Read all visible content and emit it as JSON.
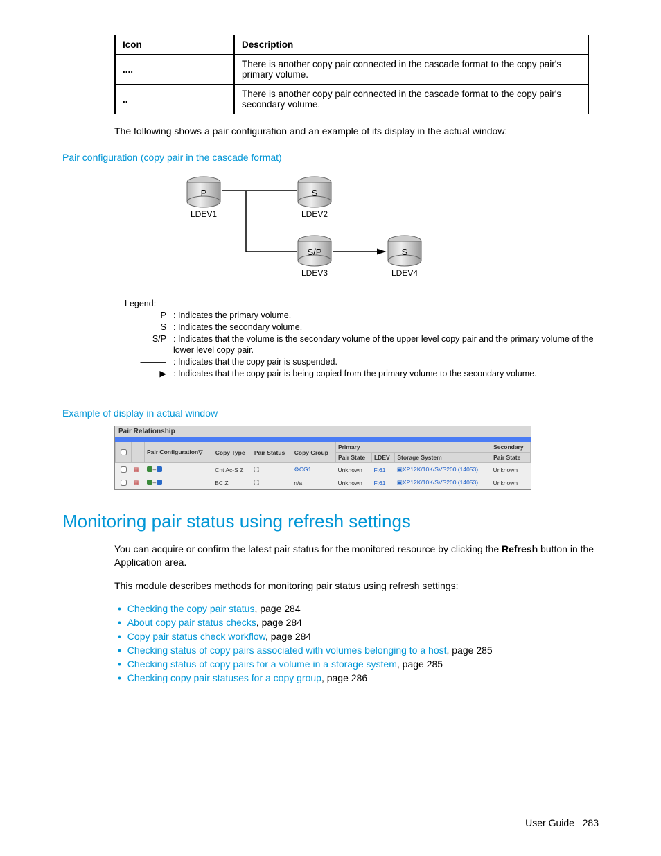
{
  "icon_table": {
    "headers": {
      "icon": "Icon",
      "desc": "Description"
    },
    "rows": [
      {
        "icon": "....",
        "desc": "There is another copy pair connected in the cascade format to the copy pair's primary volume."
      },
      {
        "icon": "..",
        "desc": "There is another copy pair connected in the cascade format to the copy pair's secondary volume."
      }
    ]
  },
  "para1": "The following shows a pair configuration and an example of its display in the actual window:",
  "caption1": "Pair configuration (copy pair in the cascade format)",
  "diagram": {
    "p": "P",
    "s": "S",
    "sp": "S/P",
    "ldev1": "LDEV1",
    "ldev2": "LDEV2",
    "ldev3": "LDEV3",
    "ldev4": "LDEV4",
    "legend_title": "Legend:",
    "legend": [
      {
        "sym": "P",
        "text": ": Indicates the primary volume."
      },
      {
        "sym": "S",
        "text": ": Indicates the secondary volume."
      },
      {
        "sym": "S/P",
        "text": ": Indicates that the volume is the secondary volume of the upper level copy pair and the primary volume of the lower level copy pair."
      },
      {
        "sym": "———",
        "text": ": Indicates that the copy pair is suspended."
      },
      {
        "sym": "——▶",
        "text": ": Indicates that the copy pair is being copied from the primary volume to the secondary volume."
      }
    ]
  },
  "caption2": "Example of display in actual window",
  "screenshot": {
    "title": "Pair Relationship",
    "headers": {
      "chk": "",
      "icon": "",
      "pairconf": "Pair Configuration▽",
      "copytype": "Copy Type",
      "pairstatus": "Pair Status",
      "copygroup": "Copy Group",
      "primary": "Primary",
      "secondary": "Secondary",
      "pairstate": "Pair State",
      "ldev": "LDEV",
      "storage": "Storage System",
      "pairstate2": "Pair State"
    },
    "rows": [
      {
        "copytype": "Cnt Ac-S Z",
        "pairstatus": "⬚",
        "copygroup": "CG1",
        "cg_link": true,
        "pairstate": "Unknown",
        "ldev": "F:61",
        "storage": "XP12K/10K/SVS200 (14053)",
        "pairstate2": "Unknown"
      },
      {
        "copytype": "BC Z",
        "pairstatus": "⬚",
        "copygroup": "n/a",
        "cg_link": false,
        "pairstate": "Unknown",
        "ldev": "F:61",
        "storage": "XP12K/10K/SVS200 (14053)",
        "pairstate2": "Unknown"
      }
    ]
  },
  "section_heading": "Monitoring pair status using refresh settings",
  "para2a": "You can acquire or confirm the latest pair status for the monitored resource by clicking the ",
  "para2b": "Refresh",
  "para2c": " button in the Application area.",
  "para3": "This module describes methods for monitoring pair status using refresh settings:",
  "links": [
    {
      "text": "Checking the copy pair status",
      "page": ", page 284"
    },
    {
      "text": "About copy pair status checks",
      "page": ", page 284"
    },
    {
      "text": "Copy pair status check workflow",
      "page": ", page 284"
    },
    {
      "text": "Checking status of copy pairs associated with volumes belonging to a host",
      "page": ", page 285"
    },
    {
      "text": "Checking status of copy pairs for a volume in a storage system",
      "page": ", page 285"
    },
    {
      "text": "Checking copy pair statuses for a copy group",
      "page": ", page 286"
    }
  ],
  "footer": {
    "label": "User Guide",
    "page": "283"
  }
}
